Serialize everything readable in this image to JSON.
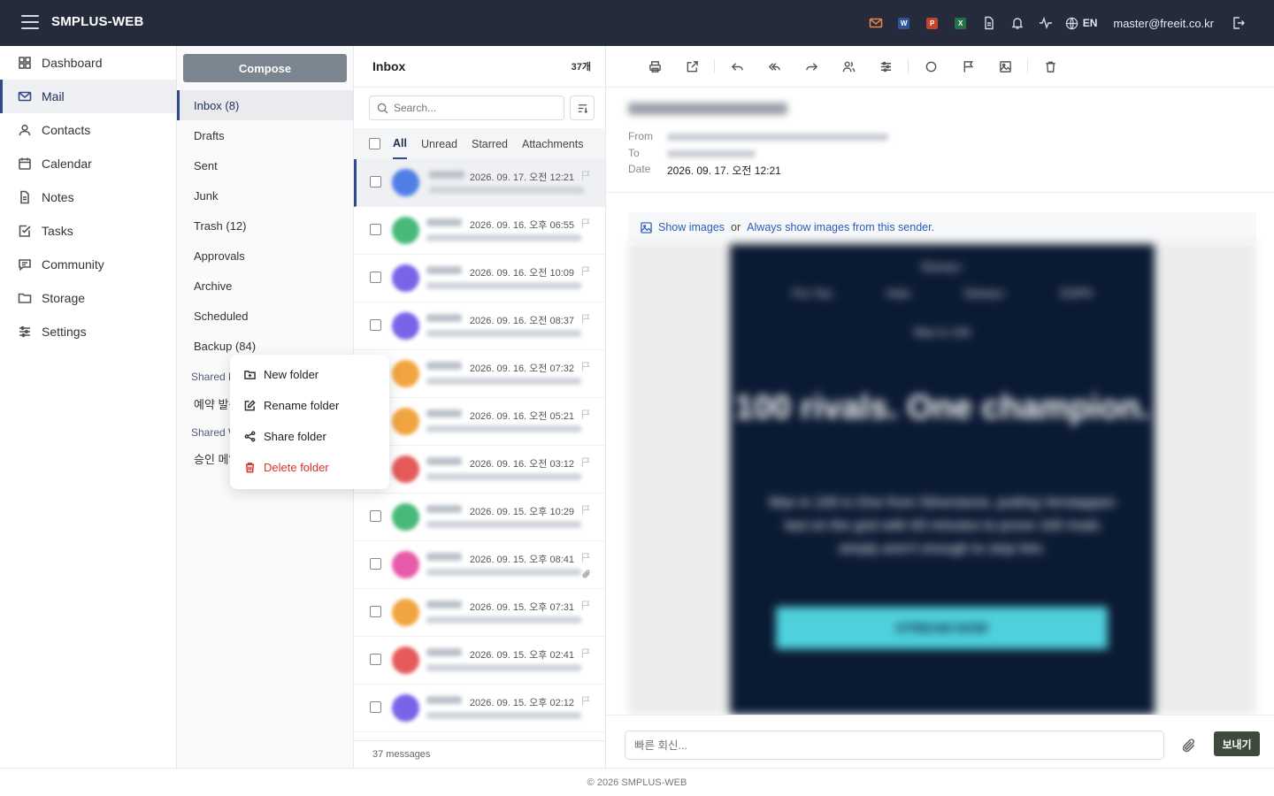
{
  "app": {
    "brand": "SMPLUS-WEB",
    "user": "master@freeit.co.kr",
    "lang": "EN"
  },
  "nav": [
    {
      "label": "Dashboard",
      "icon": "dashboard-icon"
    },
    {
      "label": "Mail",
      "icon": "mail-icon",
      "active": true
    },
    {
      "label": "Contacts",
      "icon": "contacts-icon"
    },
    {
      "label": "Calendar",
      "icon": "calendar-icon"
    },
    {
      "label": "Notes",
      "icon": "notes-icon"
    },
    {
      "label": "Tasks",
      "icon": "tasks-icon"
    },
    {
      "label": "Community",
      "icon": "community-icon"
    },
    {
      "label": "Storage",
      "icon": "folder-icon"
    },
    {
      "label": "Settings",
      "icon": "settings-icon"
    }
  ],
  "folders": {
    "compose": "Compose",
    "items": [
      "Inbox (8)",
      "Drafts",
      "Sent",
      "Junk",
      "Trash (12)",
      "Approvals",
      "Archive",
      "Scheduled",
      "Backup (84)"
    ],
    "shared_b": "Shared B",
    "shared_b_item": "예약 발송",
    "shared_w": "Shared W",
    "shared_w_item": "승인 메일"
  },
  "context_menu": {
    "new": "New folder",
    "rename": "Rename folder",
    "share": "Share folder",
    "delete": "Delete folder"
  },
  "list": {
    "title": "Inbox",
    "count": "37개",
    "search_placeholder": "Search...",
    "tabs": [
      "All",
      "Unread",
      "Starred",
      "Attachments"
    ],
    "footer": "37 messages",
    "rows": [
      {
        "date": "2026. 09. 17. 오전 12:21",
        "avatar": "#4f7fe6",
        "selected": true
      },
      {
        "date": "2026. 09. 16. 오후 06:55",
        "avatar": "#49b97a"
      },
      {
        "date": "2026. 09. 16. 오전 10:09",
        "avatar": "#7a63e8"
      },
      {
        "date": "2026. 09. 16. 오전 08:37",
        "avatar": "#7a63e8"
      },
      {
        "date": "2026. 09. 16. 오전 07:32",
        "avatar": "#f1a540"
      },
      {
        "date": "2026. 09. 16. 오전 05:21",
        "avatar": "#f1a540"
      },
      {
        "date": "2026. 09. 16. 오전 03:12",
        "avatar": "#e65a5a"
      },
      {
        "date": "2026. 09. 15. 오후 10:29",
        "avatar": "#49b97a"
      },
      {
        "date": "2026. 09. 15. 오후 08:41",
        "avatar": "#e65aa8",
        "attachment": true
      },
      {
        "date": "2026. 09. 15. 오후 07:31",
        "avatar": "#f1a540"
      },
      {
        "date": "2026. 09. 15. 오후 02:41",
        "avatar": "#e65a5a"
      },
      {
        "date": "2026. 09. 15. 오후 02:12",
        "avatar": "#7a63e8"
      }
    ]
  },
  "reader": {
    "from_label": "From",
    "to_label": "To",
    "date_label": "Date",
    "date_value": "2026. 09. 17. 오전 12:21",
    "notice_show": "Show images",
    "notice_or": "or",
    "notice_always": "Always show images from this sender.",
    "newsletter": {
      "brand": "Disney+",
      "links": [
        "For You",
        "Hulu",
        "Disney+",
        "ESPN"
      ],
      "tag": "Max in 100",
      "headline": "100 rivals. One champion.",
      "body": "Max in 100 is One from Silverstone, putting Verstappen last on the grid with 60 minutes to prove 100 rivals simply aren't enough to stop him.",
      "cta": "STREAM NOW"
    },
    "reply_placeholder": "빠른 회신...",
    "send": "보내기"
  },
  "footer": "© 2026 SMPLUS-WEB",
  "colors": {
    "topbar": "#252b3b",
    "accent": "#2f4a86",
    "danger": "#d9322b",
    "send": "#3e4a3b"
  }
}
